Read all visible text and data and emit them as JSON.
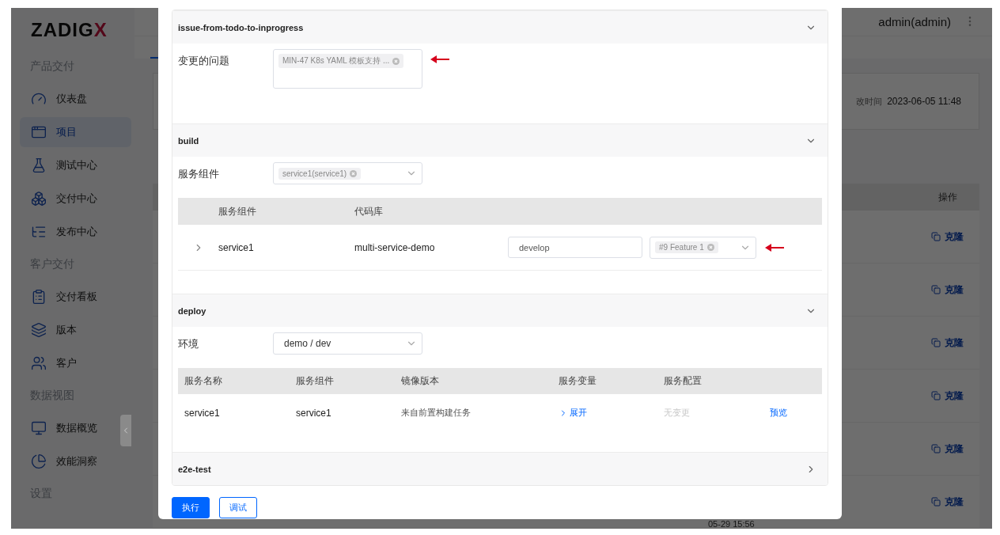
{
  "sidebar": {
    "logo": {
      "text": "ZADIG",
      "accent": "X"
    },
    "groups": [
      {
        "title": "产品交付",
        "items": [
          {
            "label": "仪表盘",
            "selected": false
          },
          {
            "label": "项目",
            "selected": true
          },
          {
            "label": "测试中心",
            "selected": false
          },
          {
            "label": "交付中心",
            "selected": false
          },
          {
            "label": "发布中心",
            "selected": false
          }
        ]
      },
      {
        "title": "客户交付",
        "items": [
          {
            "label": "交付看板",
            "selected": false
          },
          {
            "label": "版本",
            "selected": false
          },
          {
            "label": "客户",
            "selected": false
          }
        ]
      },
      {
        "title": "数据视图",
        "items": [
          {
            "label": "数据概览",
            "selected": false
          },
          {
            "label": "效能洞察",
            "selected": false
          }
        ]
      },
      {
        "title": "设置"
      }
    ]
  },
  "header": {
    "user": "admin(admin)"
  },
  "info_card": {
    "label": "改时间",
    "value": "2023-06-05 11:48"
  },
  "table": {
    "action_column": "操作",
    "rows": [
      {
        "action": "克隆"
      },
      {
        "action": "克隆"
      },
      {
        "action": "克隆"
      },
      {
        "action": "克隆"
      },
      {
        "action": "克隆"
      },
      {
        "action": "克隆",
        "time": "05-29 15:56"
      }
    ]
  },
  "dialog": {
    "sections": [
      {
        "kind": "issue",
        "title": "issue-from-todo-to-inprogress",
        "expanded": true,
        "label": "变更的问题",
        "tags": [
          "MIN-47 K8s YAML 模板支持 ..."
        ],
        "marked": true
      },
      {
        "kind": "build",
        "title": "build",
        "expanded": true,
        "label": "服务组件",
        "tags": [
          "service1(service1)"
        ],
        "columns": [
          "服务组件",
          "代码库"
        ],
        "rows": [
          {
            "service": "service1",
            "repo": "multi-service-demo",
            "branch": "develop",
            "prs": [
              "#9 Feature 1"
            ],
            "marked": true
          }
        ]
      },
      {
        "kind": "deploy",
        "title": "deploy",
        "expanded": true,
        "label": "环境",
        "value": "demo / dev",
        "columns": [
          "服务名称",
          "服务组件",
          "镜像版本",
          "服务变量",
          "服务配置"
        ],
        "rows": [
          {
            "service": "service1",
            "component": "service1",
            "image": "来自前置构建任务",
            "variables": "展开",
            "config": "无变更",
            "config_changed": false,
            "preview": "预览"
          }
        ]
      },
      {
        "title": "e2e-test",
        "expanded": false
      }
    ],
    "buttons": [
      {
        "label": "执行",
        "primary": true
      },
      {
        "label": "调试",
        "primary": false
      }
    ]
  }
}
